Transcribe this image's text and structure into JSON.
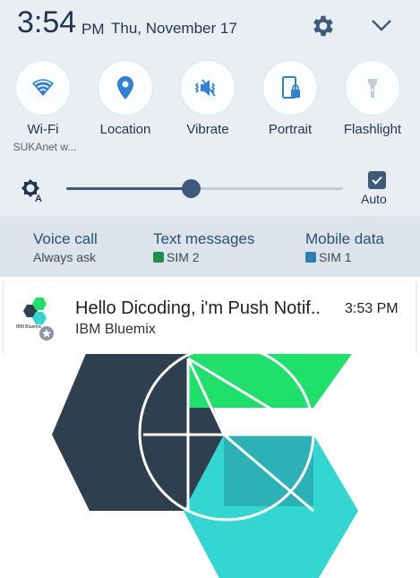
{
  "status": {
    "time": "3:54",
    "ampm": "PM",
    "date": "Thu, November 17"
  },
  "tiles": [
    {
      "label": "Wi-Fi",
      "sub": "SUKAnet w...",
      "icon": "wifi-icon"
    },
    {
      "label": "Location",
      "icon": "location-pin-icon"
    },
    {
      "label": "Vibrate",
      "icon": "vibrate-icon"
    },
    {
      "label": "Portrait",
      "icon": "portrait-lock-icon"
    },
    {
      "label": "Flashlight",
      "icon": "flashlight-icon"
    }
  ],
  "brightness": {
    "level": 0.45,
    "auto_label": "Auto",
    "auto_checked": true
  },
  "sim": [
    {
      "title": "Voice call",
      "sub": "Always ask"
    },
    {
      "title": "Text messages",
      "sub": "SIM 2",
      "sim_color": "#1f8f4a"
    },
    {
      "title": "Mobile data",
      "sub": "SIM 1",
      "sim_color": "#2a7fb3"
    }
  ],
  "notification": {
    "title": "Hello Dicoding, i'm Push Notif..",
    "app": "IBM Bluemix",
    "time": "3:53 PM",
    "icon_text": "IBM Bluemix"
  },
  "colors": {
    "accent": "#3d5a7a",
    "tile_icon": "#2f80d6",
    "text_dark": "#1f3550"
  }
}
